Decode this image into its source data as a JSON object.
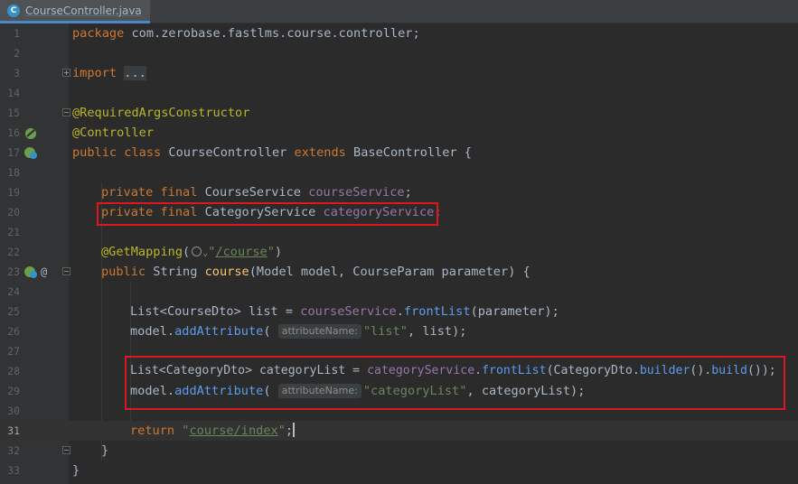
{
  "tab": {
    "title": "CourseController.java",
    "icon": "java-class-icon"
  },
  "lines": [
    {
      "num": "1",
      "code": "package com.zerobase.fastlms.course.controller;"
    },
    {
      "num": "2",
      "code": ""
    },
    {
      "num": "3",
      "code": "import ..."
    },
    {
      "num": "14",
      "code": ""
    },
    {
      "num": "15",
      "code": "@RequiredArgsConstructor"
    },
    {
      "num": "16",
      "code": "@Controller"
    },
    {
      "num": "17",
      "code": "public class CourseController extends BaseController {"
    },
    {
      "num": "18",
      "code": ""
    },
    {
      "num": "19",
      "code": "private final CourseService courseService;"
    },
    {
      "num": "20",
      "code": "private final CategoryService categoryService;"
    },
    {
      "num": "21",
      "code": ""
    },
    {
      "num": "22",
      "code": "@GetMapping(\"/course\")"
    },
    {
      "num": "23",
      "code": "public String course(Model model, CourseParam parameter) {"
    },
    {
      "num": "24",
      "code": ""
    },
    {
      "num": "25",
      "code": "List<CourseDto> list = courseService.frontList(parameter);"
    },
    {
      "num": "26",
      "code": "model.addAttribute( attributeName: \"list\", list);"
    },
    {
      "num": "27",
      "code": ""
    },
    {
      "num": "28",
      "code": "List<CategoryDto> categoryList = categoryService.frontList(CategoryDto.builder().build());"
    },
    {
      "num": "29",
      "code": "model.addAttribute( attributeName: \"categoryList\", categoryList);"
    },
    {
      "num": "30",
      "code": ""
    },
    {
      "num": "31",
      "code": "return \"course/index\";"
    },
    {
      "num": "32",
      "code": "}"
    },
    {
      "num": "33",
      "code": "}"
    }
  ],
  "tokens": {
    "package": "package",
    "pkg_name": "com.zerobase.fastlms.course.controller",
    "import": "import",
    "ellipsis": "...",
    "ann_rac": "@RequiredArgsConstructor",
    "ann_controller": "@Controller",
    "public": "public",
    "class": "class",
    "extends": "extends",
    "class_name": "CourseController",
    "base_class": "BaseController",
    "private": "private",
    "final": "final",
    "CourseService": "CourseService",
    "courseService": "courseService",
    "CategoryService": "CategoryService",
    "categoryService": "categoryService",
    "ann_getmapping": "@GetMapping",
    "course_path": "/course",
    "String": "String",
    "course": "course",
    "Model": "Model",
    "model": "model",
    "CourseParam": "CourseParam",
    "parameter": "parameter",
    "List": "List",
    "CourseDto": "CourseDto",
    "list": "list",
    "frontList": "frontList",
    "addAttribute": "addAttribute",
    "hint_attr": "attributeName:",
    "str_list": "list",
    "CategoryDto": "CategoryDto",
    "categoryList": "categoryList",
    "builder": "builder",
    "build": "build",
    "str_categoryList": "categoryList",
    "return": "return",
    "return_path": "course/index"
  },
  "colors": {
    "background": "#2b2b2b",
    "keyword": "#cc7832",
    "annotation": "#bbb529",
    "field": "#9876aa",
    "string": "#6a8759",
    "method": "#ffc66d",
    "highlight_box": "#e0161e"
  }
}
